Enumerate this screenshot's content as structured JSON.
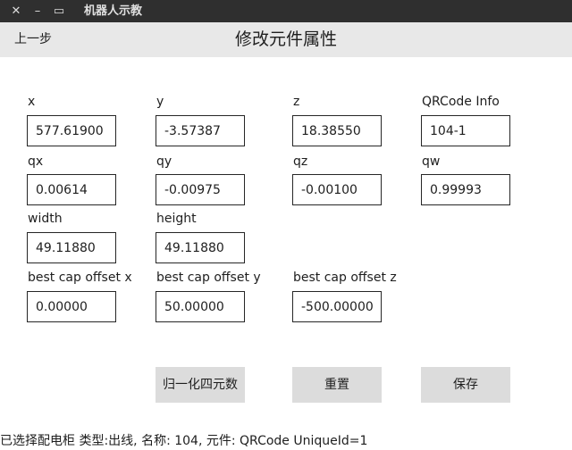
{
  "window": {
    "title": "机器人示教",
    "close_glyph": "✕",
    "min_glyph": "–",
    "max_glyph": "▭"
  },
  "header": {
    "back_label": "上一步",
    "title": "修改元件属性"
  },
  "fields": {
    "x": {
      "label": "x",
      "value": "577.61900"
    },
    "y": {
      "label": "y",
      "value": "-3.57387"
    },
    "z": {
      "label": "z",
      "value": "18.38550"
    },
    "qrcode": {
      "label": "QRCode Info",
      "value": "104-1"
    },
    "qx": {
      "label": "qx",
      "value": "0.00614"
    },
    "qy": {
      "label": "qy",
      "value": "-0.00975"
    },
    "qz": {
      "label": "qz",
      "value": "-0.00100"
    },
    "qw": {
      "label": "qw",
      "value": "0.99993"
    },
    "width": {
      "label": "width",
      "value": "49.11880"
    },
    "height": {
      "label": "height",
      "value": "49.11880"
    },
    "cap_x": {
      "label": "best cap offset x",
      "value": "0.00000"
    },
    "cap_y": {
      "label": "best cap offset y",
      "value": "50.00000"
    },
    "cap_z": {
      "label": "best cap offset z",
      "value": "-500.00000"
    }
  },
  "buttons": {
    "normalize": "归一化四元数",
    "reset": "重置",
    "save": "保存"
  },
  "status_text": "已选择配电柜 类型:出线, 名称: 104, 元件: QRCode UniqueId=1"
}
